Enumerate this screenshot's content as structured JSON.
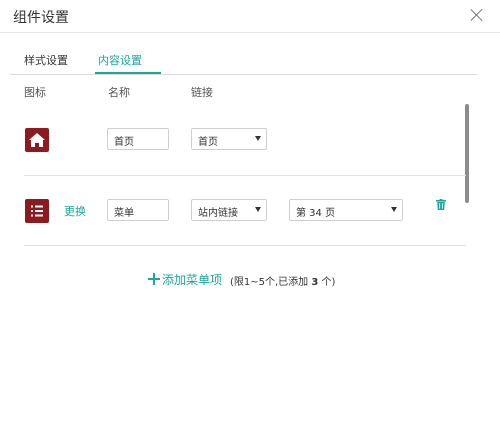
{
  "dialog": {
    "title": "组件设置"
  },
  "tabs": [
    {
      "label": "样式设置"
    },
    {
      "label": "内容设置"
    }
  ],
  "columns": {
    "icon": "图标",
    "name": "名称",
    "link": "链接"
  },
  "rows": [
    {
      "icon": "home-icon",
      "name": "首页",
      "link_type": "首页"
    },
    {
      "icon": "menu-list-icon",
      "replace_label": "更换",
      "name": "菜单",
      "link_type": "站内链接",
      "page": "第 34 页"
    }
  ],
  "add_item": {
    "label": "添加菜单项",
    "hint_prefix": "(限1~5个,已添加 ",
    "count": "3",
    "hint_suffix": " 个)"
  },
  "colors": {
    "accent": "#1aa89b",
    "icon_bg": "#8d1a1f"
  }
}
